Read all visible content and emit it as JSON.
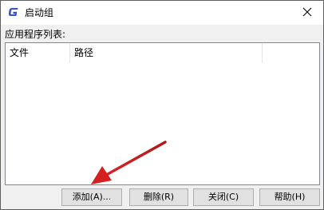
{
  "window": {
    "title": "启动组",
    "close_glyph": "✕",
    "icon": "app-g-icon"
  },
  "list": {
    "label": "应用程序列表:",
    "columns": [
      "文件",
      "路径",
      ""
    ]
  },
  "buttons": {
    "add": "添加(A)...",
    "delete": "删除(R)",
    "close": "关闭(C)",
    "help": "帮助(H)"
  },
  "colors": {
    "accent_icon": "#3a4fd8",
    "annotation_arrow": "#d42020"
  }
}
